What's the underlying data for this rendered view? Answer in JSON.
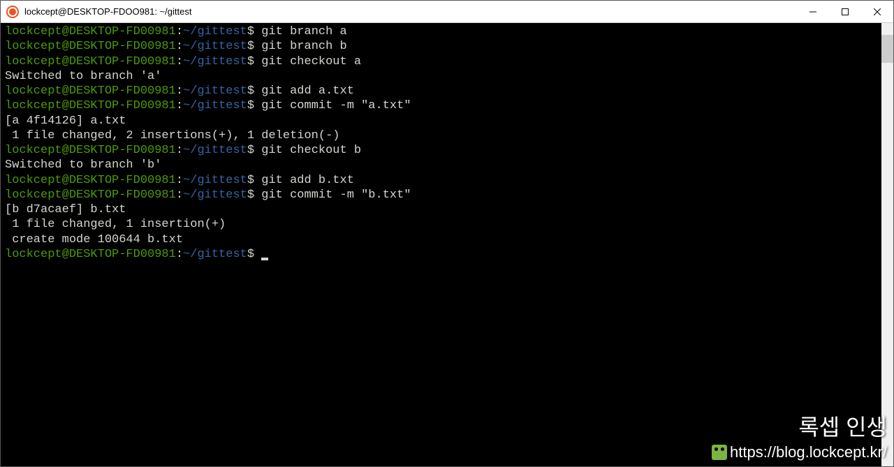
{
  "window": {
    "title": "lockcept@DESKTOP-FDOO981: ~/gittest"
  },
  "prompt": {
    "user": "lockcept@DESKTOP-FD00981",
    "sep": ":",
    "path": "~/gittest",
    "symbol": "$"
  },
  "lines": [
    {
      "type": "prompt",
      "cmd": "git branch a"
    },
    {
      "type": "prompt",
      "cmd": "git branch b"
    },
    {
      "type": "prompt",
      "cmd": "git checkout a"
    },
    {
      "type": "output",
      "text": "Switched to branch 'a'"
    },
    {
      "type": "prompt",
      "cmd": "git add a.txt"
    },
    {
      "type": "prompt",
      "cmd": "git commit -m \"a.txt\""
    },
    {
      "type": "output",
      "text": "[a 4f14126] a.txt"
    },
    {
      "type": "output",
      "text": " 1 file changed, 2 insertions(+), 1 deletion(-)"
    },
    {
      "type": "prompt",
      "cmd": "git checkout b"
    },
    {
      "type": "output",
      "text": "Switched to branch 'b'"
    },
    {
      "type": "prompt",
      "cmd": "git add b.txt"
    },
    {
      "type": "prompt",
      "cmd": "git commit -m \"b.txt\""
    },
    {
      "type": "output",
      "text": "[b d7acaef] b.txt"
    },
    {
      "type": "output",
      "text": " 1 file changed, 1 insertion(+)"
    },
    {
      "type": "output",
      "text": " create mode 100644 b.txt"
    },
    {
      "type": "prompt",
      "cmd": "",
      "cursor": true
    }
  ],
  "watermark": {
    "title": "록셉 인생",
    "url": "https://blog.lockcept.kr/"
  }
}
